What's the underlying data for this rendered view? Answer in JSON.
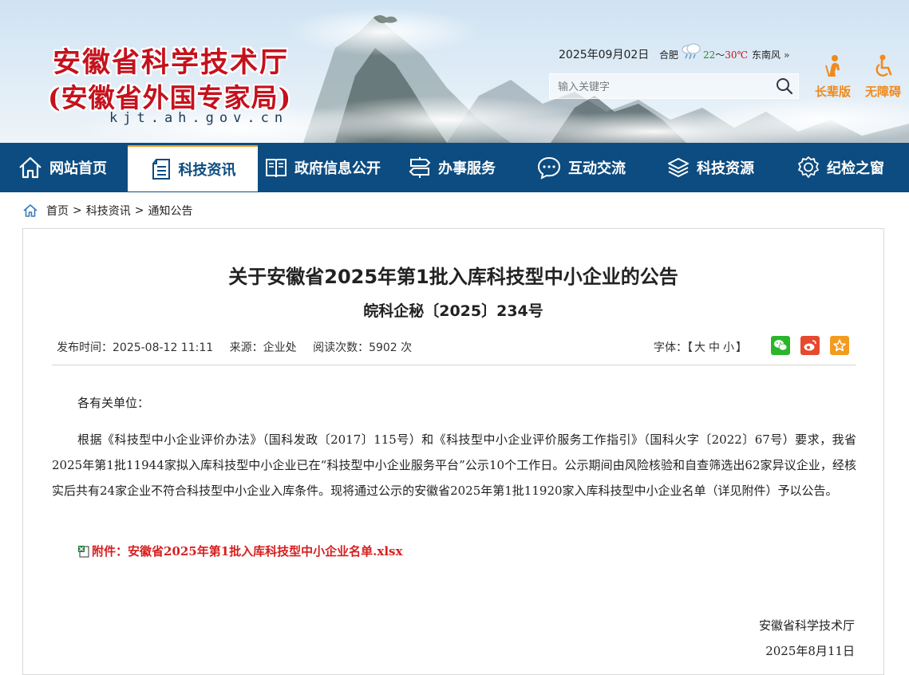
{
  "header": {
    "logo_line1": "安徽省科学技术厅",
    "logo_line2": "(安徽省外国专家局)",
    "logo_domain": "kjt.ah.gov.cn",
    "date": "2025年09月02日",
    "city": "合肥",
    "weather_icon": "cloud-rain-icon",
    "temp_low": "22",
    "temp_sep": "～",
    "temp_high": "30℃",
    "wind": "东南风",
    "wind_chevron": "»",
    "search_placeholder": "输入关键字",
    "elder_label": "长辈版",
    "access_label": "无障碍",
    "accent_color": "#f08a1c",
    "logo_color": "#c4121d"
  },
  "nav": {
    "bar_color": "#0d4c80",
    "items": [
      {
        "label": "网站首页",
        "icon": "home-icon"
      },
      {
        "label": "科技资讯",
        "icon": "document-icon",
        "active": true
      },
      {
        "label": "政府信息公开",
        "icon": "book-icon"
      },
      {
        "label": "办事服务",
        "icon": "signpost-icon"
      },
      {
        "label": "互动交流",
        "icon": "chat-icon"
      },
      {
        "label": "科技资源",
        "icon": "layers-icon"
      },
      {
        "label": "纪检之窗",
        "icon": "badge-icon"
      }
    ]
  },
  "breadcrumb": {
    "items": [
      "首页",
      "科技资讯",
      "通知公告"
    ],
    "separator": ">"
  },
  "article": {
    "title": "关于安徽省2025年第1批入库科技型中小企业的公告",
    "doc_no": "皖科企秘〔2025〕234号",
    "publish_time": "发布时间：2025-08-12 11:11",
    "source": "来源：企业处",
    "views": "阅读次数：5902 次",
    "font_label": "字体：",
    "font_open": "【",
    "font_large": "大",
    "font_medium": "中",
    "font_small": "小",
    "font_close": "】",
    "greeting": "各有关单位：",
    "body": "根据《科技型中小企业评价办法》（国科发政〔2017〕115号）和《科技型中小企业评价服务工作指引》（国科火字〔2022〕67号）要求，我省2025年第1批11944家拟入库科技型中小企业已在“科技型中小企业服务平台”公示10个工作日。公示期间由风险核验和自查筛选出62家异议企业，经核实后共有24家企业不符合科技型中小企业入库条件。现将通过公示的安徽省2025年第1批11920家入库科技型中小企业名单（详见附件）予以公告。",
    "attachment": "附件：安徽省2025年第1批入库科技型中小企业名单.xlsx",
    "signature_org": "安徽省科学技术厅",
    "signature_date": "2025年8月11日"
  }
}
